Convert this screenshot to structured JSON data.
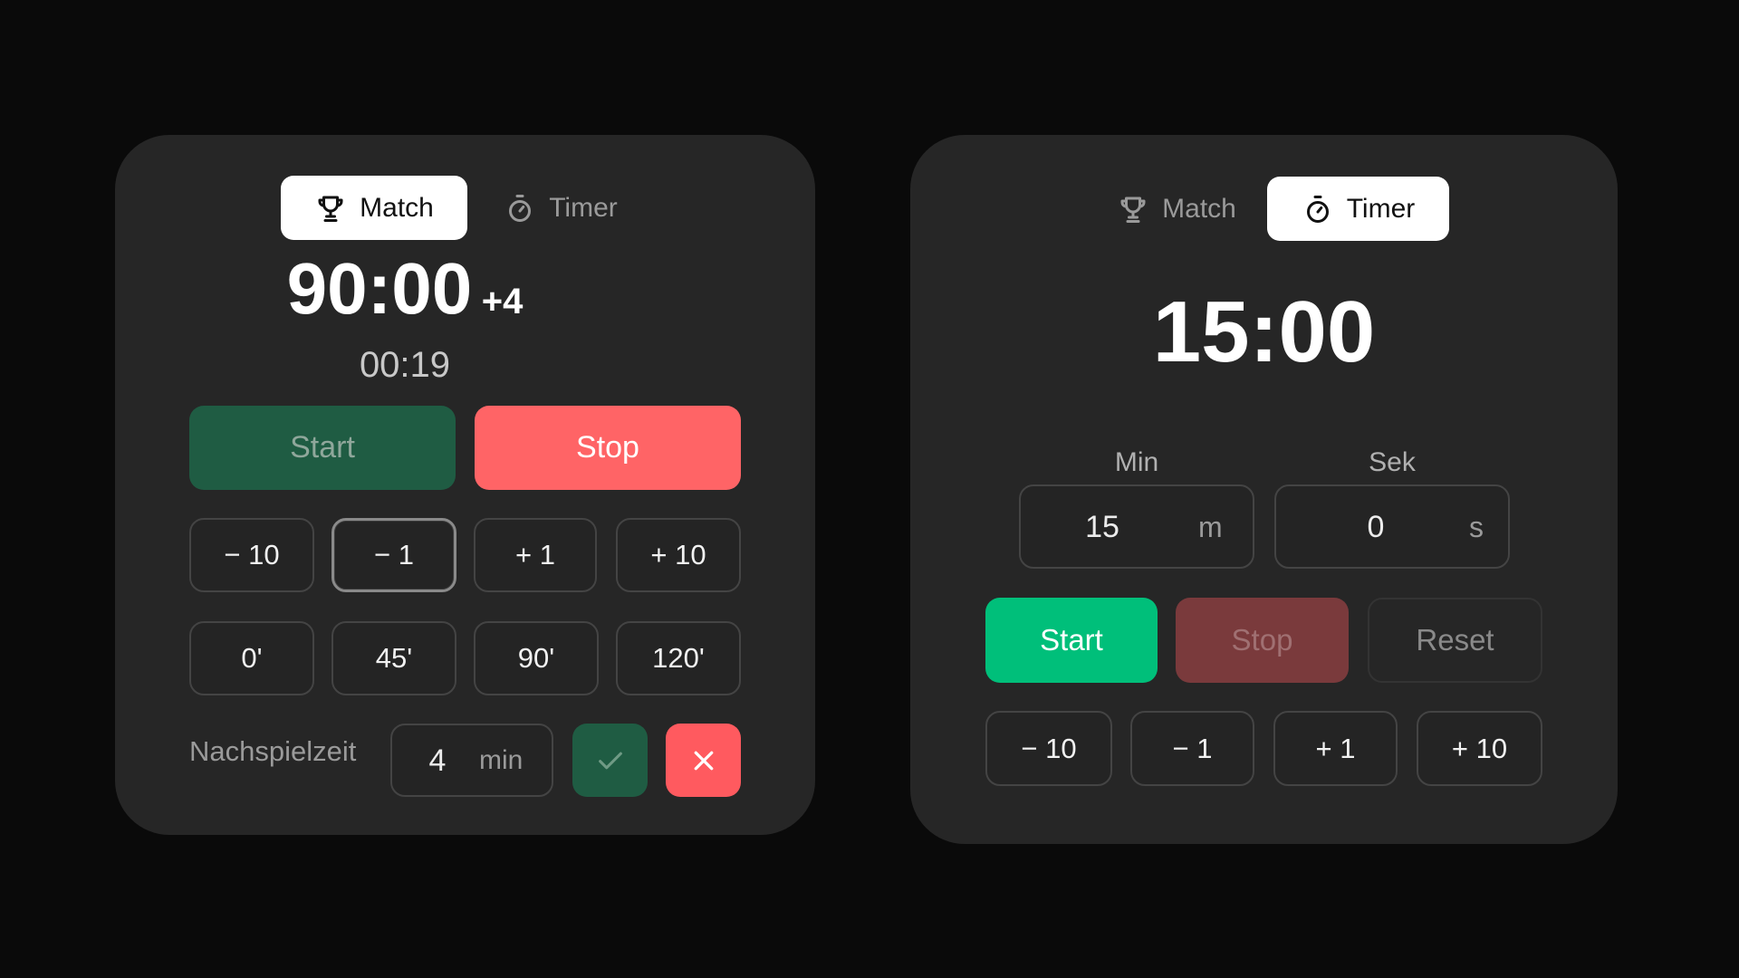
{
  "match_panel": {
    "tabs": {
      "match_label": "Match",
      "timer_label": "Timer",
      "active": "match"
    },
    "clock": {
      "main": "90:00",
      "added": "+4",
      "elapsed": "00:19"
    },
    "start_label": "Start",
    "stop_label": "Stop",
    "adjust_buttons": [
      "− 10",
      "− 1",
      "+ 1",
      "+ 10"
    ],
    "preset_buttons": [
      "0'",
      "45'",
      "90'",
      "120'"
    ],
    "stoppage": {
      "label": "Nachspielzeit",
      "value": "4",
      "unit": "min"
    }
  },
  "timer_panel": {
    "tabs": {
      "match_label": "Match",
      "timer_label": "Timer",
      "active": "timer"
    },
    "clock": "15:00",
    "min_label": "Min",
    "sec_label": "Sek",
    "min_value": "15",
    "min_unit": "m",
    "sec_value": "0",
    "sec_unit": "s",
    "start_label": "Start",
    "stop_label": "Stop",
    "reset_label": "Reset",
    "adjust_buttons": [
      "− 10",
      "− 1",
      "+ 1",
      "+ 10"
    ]
  },
  "colors": {
    "background": "#0a0a0a",
    "panel": "#262626",
    "start_dim": "#1f5c43",
    "start_active": "#00bf7a",
    "stop_active": "#ff6466",
    "stop_dim": "#7a3a3c",
    "confirm": "#1f5c43",
    "cancel": "#ff5a5f"
  },
  "icons": [
    "trophy-icon",
    "stopwatch-icon",
    "check-icon",
    "close-icon"
  ]
}
